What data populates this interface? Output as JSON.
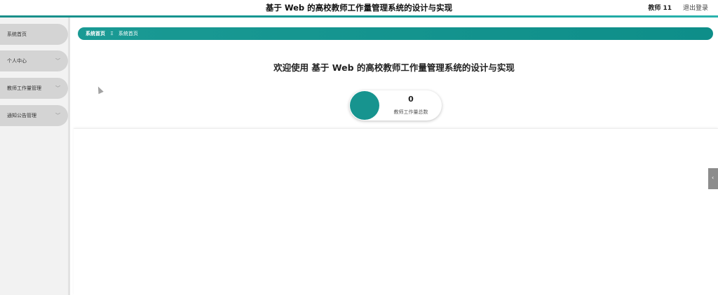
{
  "header": {
    "title": "基于 Web 的高校教师工作量管理系统的设计与实现",
    "user": "教师 11",
    "logout": "退出登录"
  },
  "sidebar": {
    "items": [
      {
        "label": "系统首页",
        "has_chevron": false
      },
      {
        "label": "个人中心",
        "has_chevron": true
      },
      {
        "label": "教师工作量管理",
        "has_chevron": true
      },
      {
        "label": "通知公告管理",
        "has_chevron": true
      }
    ]
  },
  "breadcrumb": {
    "home": "系统首页",
    "separator": "Ξ",
    "current": "系统首页"
  },
  "main": {
    "welcome": "欢迎使用 基于 Web 的高校教师工作量管理系统的设计与实现",
    "stat": {
      "value": "0",
      "label": "教师工作量总数"
    }
  },
  "colors": {
    "accent": "#17948f",
    "sidebar_item": "#d4d4d4"
  },
  "icons": {
    "chevron": "chevron-down-icon",
    "collapse": "chevron-left-icon"
  }
}
